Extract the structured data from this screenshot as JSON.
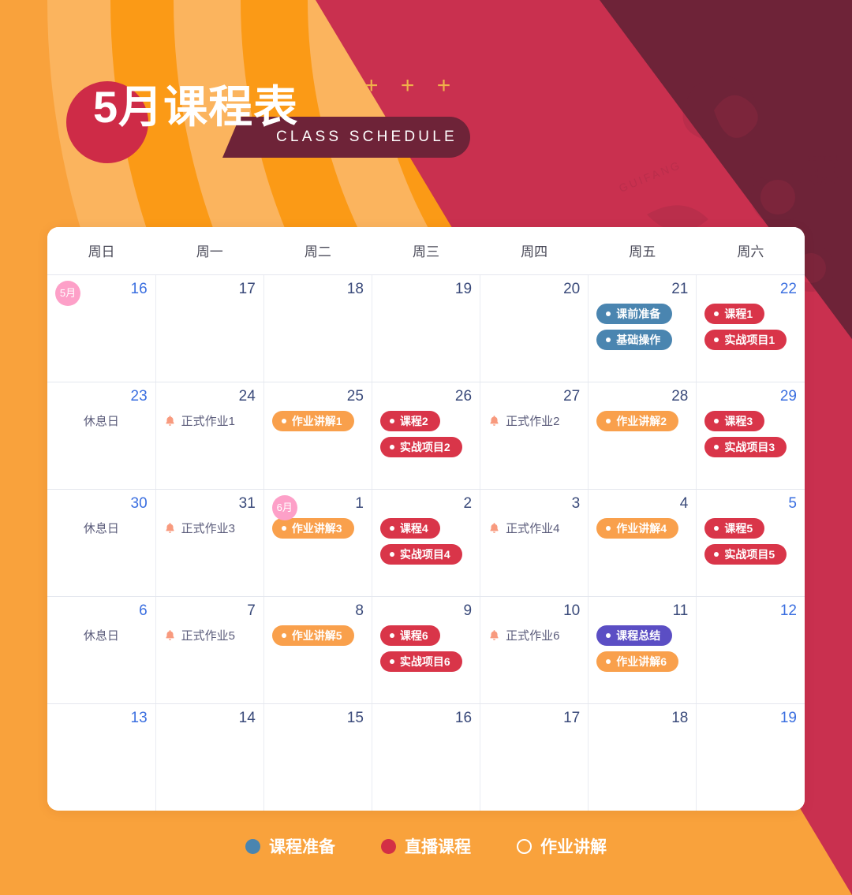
{
  "header": {
    "title": "5月课程表",
    "subtitle": "CLASS SCHEDULE",
    "plus_decoration": "+ + +"
  },
  "calendar": {
    "weekday_headers": [
      "周日",
      "周一",
      "周二",
      "周三",
      "周四",
      "周五",
      "周六"
    ],
    "weeks": [
      {
        "days": [
          {
            "num": "16",
            "weekend": true,
            "month_badge": "5月",
            "events": []
          },
          {
            "num": "17",
            "weekend": false,
            "events": []
          },
          {
            "num": "18",
            "weekend": false,
            "events": []
          },
          {
            "num": "19",
            "weekend": false,
            "events": []
          },
          {
            "num": "20",
            "weekend": false,
            "events": []
          },
          {
            "num": "21",
            "weekend": false,
            "events": [
              {
                "kind": "pill",
                "color": "blue",
                "label": "课前准备"
              },
              {
                "kind": "pill",
                "color": "blue",
                "label": "基础操作"
              }
            ]
          },
          {
            "num": "22",
            "weekend": true,
            "events": [
              {
                "kind": "pill",
                "color": "red",
                "label": "课程1"
              },
              {
                "kind": "pill",
                "color": "red",
                "label": "实战项目1"
              }
            ]
          }
        ]
      },
      {
        "days": [
          {
            "num": "23",
            "weekend": true,
            "events": [
              {
                "kind": "rest",
                "label": "休息日"
              }
            ]
          },
          {
            "num": "24",
            "weekend": false,
            "events": [
              {
                "kind": "bell",
                "label": "正式作业1"
              }
            ]
          },
          {
            "num": "25",
            "weekend": false,
            "events": [
              {
                "kind": "pill",
                "color": "orange",
                "label": "作业讲解1"
              }
            ]
          },
          {
            "num": "26",
            "weekend": false,
            "events": [
              {
                "kind": "pill",
                "color": "red",
                "label": "课程2"
              },
              {
                "kind": "pill",
                "color": "red",
                "label": "实战项目2"
              }
            ]
          },
          {
            "num": "27",
            "weekend": false,
            "events": [
              {
                "kind": "bell",
                "label": "正式作业2"
              }
            ]
          },
          {
            "num": "28",
            "weekend": false,
            "events": [
              {
                "kind": "pill",
                "color": "orange",
                "label": "作业讲解2"
              }
            ]
          },
          {
            "num": "29",
            "weekend": true,
            "events": [
              {
                "kind": "pill",
                "color": "red",
                "label": "课程3"
              },
              {
                "kind": "pill",
                "color": "red",
                "label": "实战项目3"
              }
            ]
          }
        ]
      },
      {
        "days": [
          {
            "num": "30",
            "weekend": true,
            "events": [
              {
                "kind": "rest",
                "label": "休息日"
              }
            ]
          },
          {
            "num": "31",
            "weekend": false,
            "events": [
              {
                "kind": "bell",
                "label": "正式作业3"
              }
            ]
          },
          {
            "num": "1",
            "weekend": false,
            "month_badge": "6月",
            "events": [
              {
                "kind": "pill",
                "color": "orange",
                "label": "作业讲解3"
              }
            ]
          },
          {
            "num": "2",
            "weekend": false,
            "events": [
              {
                "kind": "pill",
                "color": "red",
                "label": "课程4"
              },
              {
                "kind": "pill",
                "color": "red",
                "label": "实战项目4"
              }
            ]
          },
          {
            "num": "3",
            "weekend": false,
            "events": [
              {
                "kind": "bell",
                "label": "正式作业4"
              }
            ]
          },
          {
            "num": "4",
            "weekend": false,
            "events": [
              {
                "kind": "pill",
                "color": "orange",
                "label": "作业讲解4"
              }
            ]
          },
          {
            "num": "5",
            "weekend": true,
            "events": [
              {
                "kind": "pill",
                "color": "red",
                "label": "课程5"
              },
              {
                "kind": "pill",
                "color": "red",
                "label": "实战项目5"
              }
            ]
          }
        ]
      },
      {
        "days": [
          {
            "num": "6",
            "weekend": true,
            "events": [
              {
                "kind": "rest",
                "label": "休息日"
              }
            ]
          },
          {
            "num": "7",
            "weekend": false,
            "events": [
              {
                "kind": "bell",
                "label": "正式作业5"
              }
            ]
          },
          {
            "num": "8",
            "weekend": false,
            "events": [
              {
                "kind": "pill",
                "color": "orange",
                "label": "作业讲解5"
              }
            ]
          },
          {
            "num": "9",
            "weekend": false,
            "events": [
              {
                "kind": "pill",
                "color": "red",
                "label": "课程6"
              },
              {
                "kind": "pill",
                "color": "red",
                "label": "实战项目6"
              }
            ]
          },
          {
            "num": "10",
            "weekend": false,
            "events": [
              {
                "kind": "bell",
                "label": "正式作业6"
              }
            ]
          },
          {
            "num": "11",
            "weekend": false,
            "events": [
              {
                "kind": "pill",
                "color": "purple",
                "label": "课程总结"
              },
              {
                "kind": "pill",
                "color": "orange",
                "label": "作业讲解6"
              }
            ]
          },
          {
            "num": "12",
            "weekend": true,
            "events": []
          }
        ]
      },
      {
        "days": [
          {
            "num": "13",
            "weekend": true,
            "events": []
          },
          {
            "num": "14",
            "weekend": false,
            "events": []
          },
          {
            "num": "15",
            "weekend": false,
            "events": []
          },
          {
            "num": "16",
            "weekend": false,
            "events": []
          },
          {
            "num": "17",
            "weekend": false,
            "events": []
          },
          {
            "num": "18",
            "weekend": false,
            "events": []
          },
          {
            "num": "19",
            "weekend": true,
            "events": []
          }
        ]
      }
    ]
  },
  "legend": [
    {
      "label": "课程准备",
      "style": "filled",
      "color": "#4a85b0"
    },
    {
      "label": "直播课程",
      "style": "filled",
      "color": "#d32f45"
    },
    {
      "label": "作业讲解",
      "style": "outline",
      "color": "#ffffff"
    }
  ],
  "colors": {
    "page_background": "#f9a23c",
    "arc_light": "#fbb45e",
    "arc_dark": "#fb9a16",
    "crimson": "#c9304f",
    "maroon": "#6e2338",
    "title_circle": "#ce2b47",
    "weekend_cell": "#f1f6fe",
    "weekend_date": "#3b6fe0",
    "weekday_date": "#3a4a7a",
    "pill_blue": "#4a85b0",
    "pill_red": "#d93549",
    "pill_orange": "#f9a04c",
    "pill_purple": "#5b4ec4",
    "month_badge": "#fda0c8",
    "bell": "#f89a7e",
    "plain_text": "#5a5b7a"
  }
}
